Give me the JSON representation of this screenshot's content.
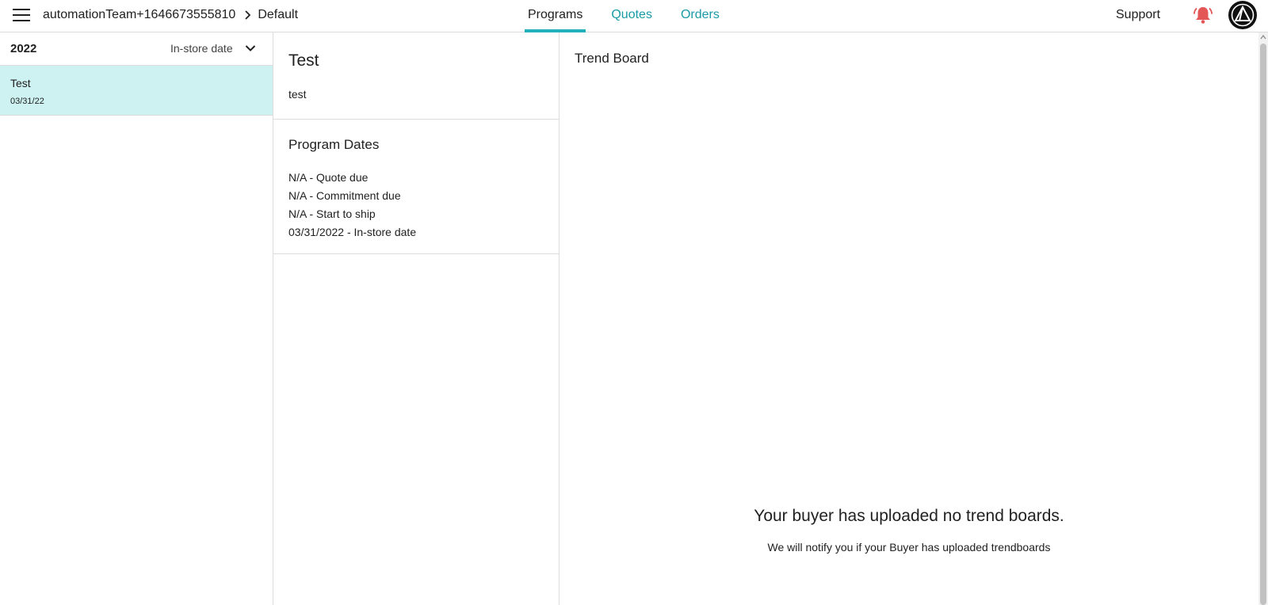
{
  "header": {
    "account": "automationTeam+1646673555810",
    "workspace": "Default",
    "tabs": [
      {
        "label": "Programs",
        "active": true
      },
      {
        "label": "Quotes",
        "active": false
      },
      {
        "label": "Orders",
        "active": false
      }
    ],
    "support_label": "Support",
    "accent_color": "#22b0bb",
    "bell_color": "#e45757",
    "icons": [
      "menu-icon",
      "chevron-right-icon",
      "bell-icon",
      "avatar-logo"
    ]
  },
  "sidebar": {
    "year": "2022",
    "sort_label": "In-store date",
    "items": [
      {
        "name": "Test",
        "date": "03/31/22",
        "selected": true
      }
    ],
    "selected_color": "#cdf2f1"
  },
  "program": {
    "title": "Test",
    "description": "test",
    "dates_title": "Program Dates",
    "dates": [
      "N/A - Quote due",
      "N/A - Commitment due",
      "N/A - Start to ship",
      "03/31/2022 - In-store date"
    ]
  },
  "trend_board": {
    "title": "Trend Board",
    "empty_title": "Your buyer has uploaded no trend boards.",
    "empty_subtitle": "We will notify you if your Buyer has uploaded trendboards"
  }
}
